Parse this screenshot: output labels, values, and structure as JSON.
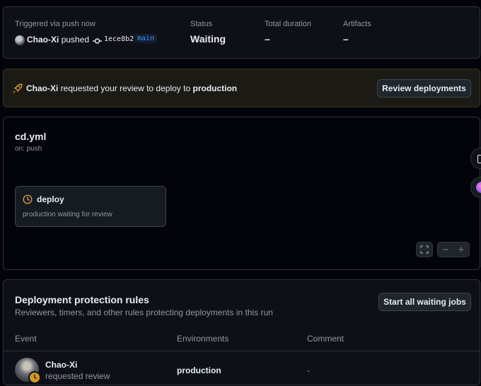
{
  "summary": {
    "trigger_label": "Triggered via push now",
    "actor": "Chao-Xi",
    "action": "pushed",
    "commit": "1ece8b2",
    "branch": "main",
    "status_label": "Status",
    "status_value": "Waiting",
    "duration_label": "Total duration",
    "duration_value": "–",
    "artifacts_label": "Artifacts",
    "artifacts_value": "–"
  },
  "banner": {
    "actor": "Chao-Xi",
    "text": "requested your review to deploy to",
    "environment": "production",
    "button_label": "Review deployments"
  },
  "workflow": {
    "file": "cd.yml",
    "trigger": "on: push",
    "job_name": "deploy",
    "job_status": "production waiting for review"
  },
  "rules": {
    "title": "Deployment protection rules",
    "subtitle": "Reviewers, timers, and other rules protecting deployments in this run",
    "button_label": "Start all waiting jobs",
    "columns": [
      "Event",
      "Environments",
      "Comment"
    ],
    "rows": [
      {
        "user": "Chao-Xi",
        "event": "requested review",
        "environment": "production",
        "comment": "-"
      }
    ]
  },
  "colors": {
    "accent_blue": "#4493f8",
    "waiting_orange": "#d29922",
    "background": "#010409",
    "panel": "#0d1117"
  }
}
